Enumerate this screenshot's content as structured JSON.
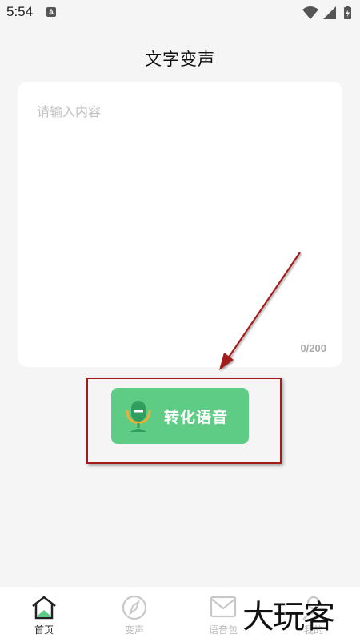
{
  "status_bar": {
    "time": "5:54",
    "notification_icon": "a-icon",
    "icons": [
      "wifi-icon",
      "signal-icon",
      "battery-icon"
    ]
  },
  "header": {
    "title": "文字变声"
  },
  "editor": {
    "placeholder": "请输入内容",
    "value": "",
    "counter": "0/200"
  },
  "convert_button": {
    "label": "转化语音",
    "icon": "microphone-icon"
  },
  "bottom_nav": {
    "items": [
      {
        "label": "首页",
        "icon": "home-icon",
        "active": true
      },
      {
        "label": "变声",
        "icon": "compass-icon",
        "active": false
      },
      {
        "label": "语音包",
        "icon": "voice-pack-icon",
        "active": false
      },
      {
        "label": "我的",
        "icon": "user-icon",
        "active": false
      }
    ]
  },
  "watermark": {
    "text": "大玩客"
  },
  "colors": {
    "accent": "#5fcc85",
    "accent_dark": "#2f9e5e",
    "annotation": "#a31c1c",
    "background": "#f5f5f5"
  }
}
